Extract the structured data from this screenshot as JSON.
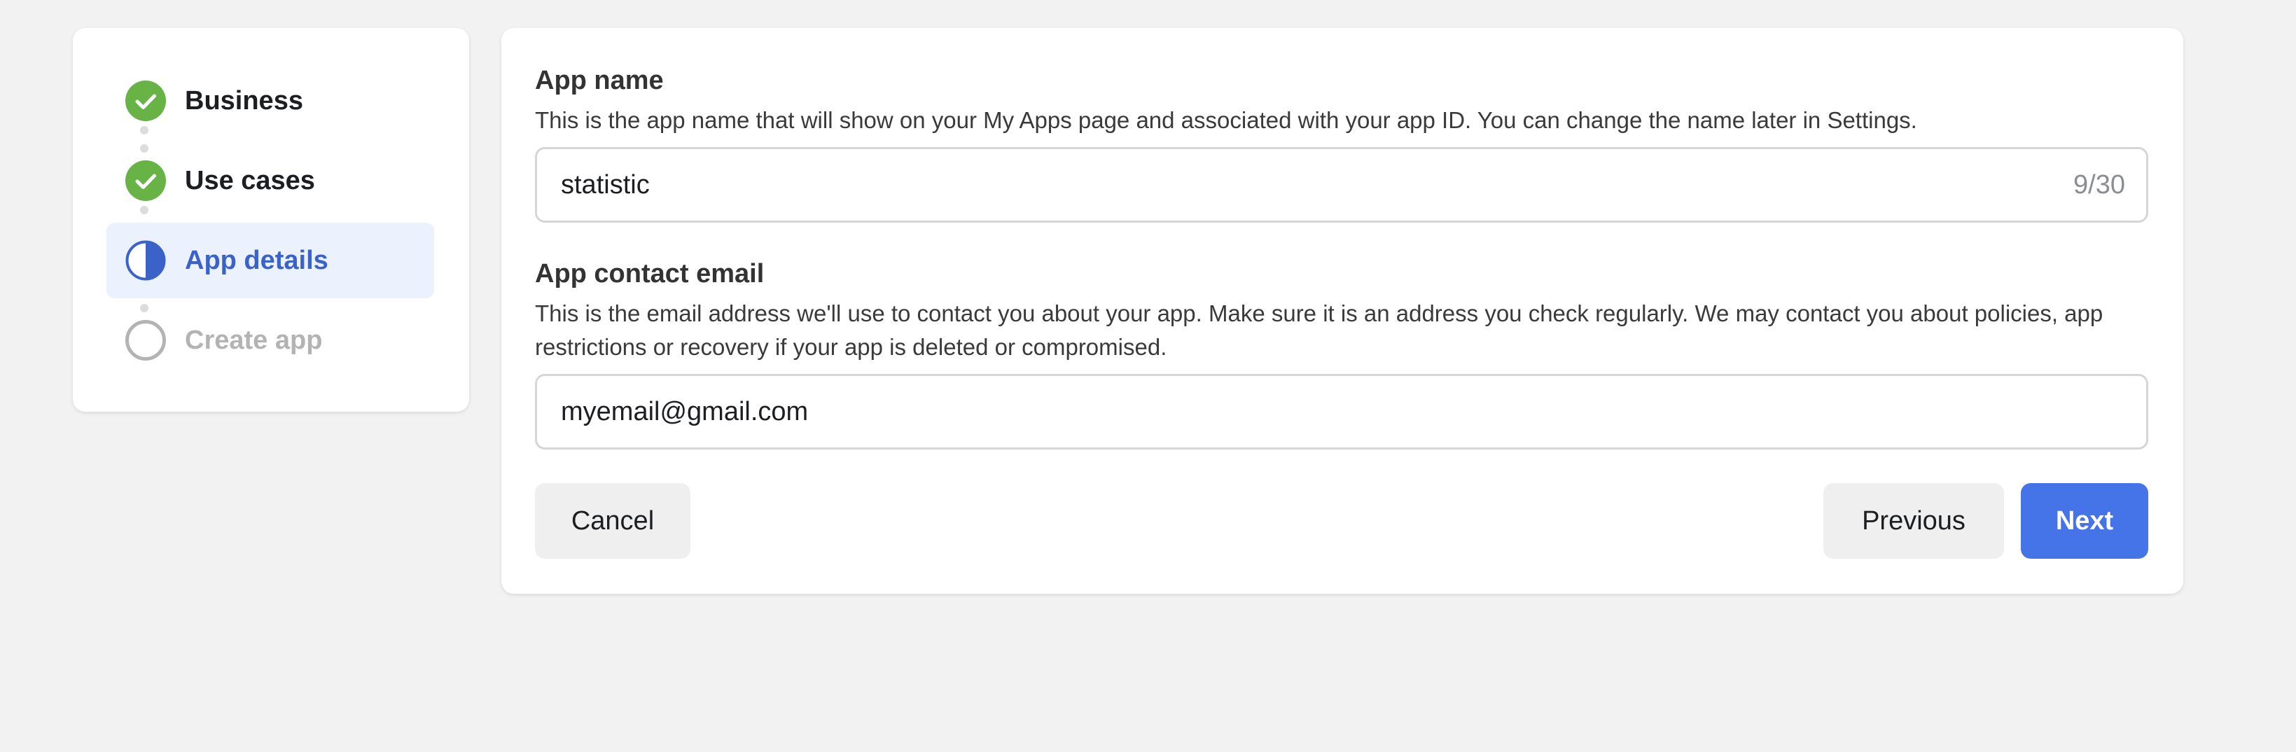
{
  "steps": [
    {
      "label": "Business",
      "status": "complete",
      "icon": "check-circle-icon"
    },
    {
      "label": "Use cases",
      "status": "complete",
      "icon": "check-circle-icon"
    },
    {
      "label": "App details",
      "status": "active",
      "icon": "half-circle-icon"
    },
    {
      "label": "Create app",
      "status": "pending",
      "icon": "empty-circle-icon"
    }
  ],
  "app_name": {
    "title": "App name",
    "description": "This is the app name that will show on your My Apps page and associated with your app ID. You can change the name later in Settings.",
    "value": "statistic",
    "counter": "9/30"
  },
  "contact_email": {
    "title": "App contact email",
    "description": "This is the email address we'll use to contact you about your app. Make sure it is an address you check regularly. We may contact you about policies, app restrictions or recovery if your app is deleted or compromised.",
    "value": "myemail@gmail.com"
  },
  "buttons": {
    "cancel": "Cancel",
    "previous": "Previous",
    "next": "Next"
  },
  "colors": {
    "complete": "#67b346",
    "active": "#3a62c8",
    "active_bg": "#ebf1fd",
    "pending": "#b3b3b3",
    "primary_button": "#4573e8"
  }
}
